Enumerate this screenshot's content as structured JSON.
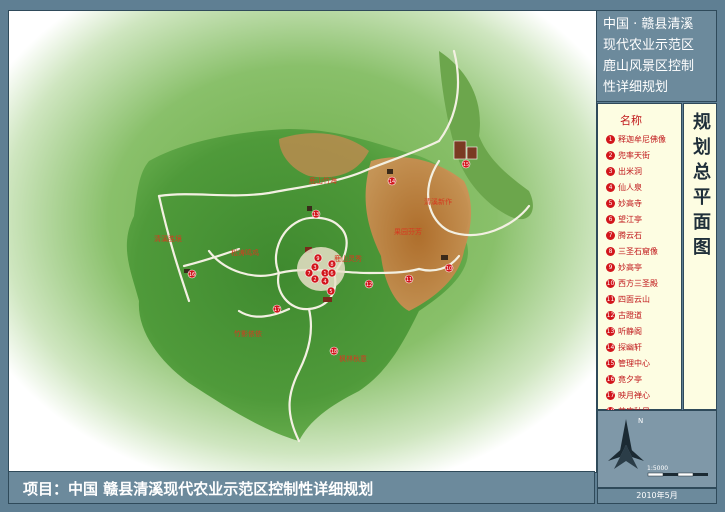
{
  "title_block": {
    "lines": [
      "中国 · 赣县清溪",
      "现代农业示范区",
      "鹿山风景区控制",
      "性详细规划"
    ]
  },
  "legend": {
    "title": "名称",
    "items": [
      {
        "num": "1",
        "label": "释迦牟尼佛像"
      },
      {
        "num": "2",
        "label": "兜率天街"
      },
      {
        "num": "3",
        "label": "出米洞"
      },
      {
        "num": "4",
        "label": "仙人泉"
      },
      {
        "num": "5",
        "label": "妙高寺"
      },
      {
        "num": "6",
        "label": "望江亭"
      },
      {
        "num": "7",
        "label": "腾云石"
      },
      {
        "num": "8",
        "label": "三圣石窟像"
      },
      {
        "num": "9",
        "label": "妙高亭"
      },
      {
        "num": "10",
        "label": "西方三圣殿"
      },
      {
        "num": "11",
        "label": "四面云山"
      },
      {
        "num": "12",
        "label": "古蹬道"
      },
      {
        "num": "13",
        "label": "听静阁"
      },
      {
        "num": "14",
        "label": "探幽轩"
      },
      {
        "num": "15",
        "label": "管理中心"
      },
      {
        "num": "16",
        "label": "竟夕亭"
      },
      {
        "num": "17",
        "label": "映月禅心"
      },
      {
        "num": "18",
        "label": "草庐秋风"
      }
    ]
  },
  "plan_title": "规划总平面图",
  "scale": "1:5000",
  "date": "2010年5月",
  "project_title": "项目：中国  赣县清溪现代农业示范区控制性详细规划",
  "map_labels": {
    "zone_bamboo": "鹿山竹海",
    "zone_fruit": "清溪新作",
    "zone_scenic_top": "鹿山灵秀",
    "zone_slope": "松涛鸣鸡",
    "zone_west": "清溪胜境",
    "zone_orchard": "果园芬芳",
    "zone_southwest": "竹影依依",
    "zone_south": "枫林秋意"
  },
  "map_markers": [
    "1",
    "2",
    "3",
    "4",
    "5",
    "6",
    "7",
    "8",
    "9",
    "10",
    "11",
    "12",
    "13",
    "14",
    "15",
    "16",
    "17",
    "18"
  ],
  "colors": {
    "frame": "#5f7f93",
    "marker_red": "#d2161c",
    "forest_green": "#4f9a3a",
    "orchard_orange": "#c8782f"
  }
}
